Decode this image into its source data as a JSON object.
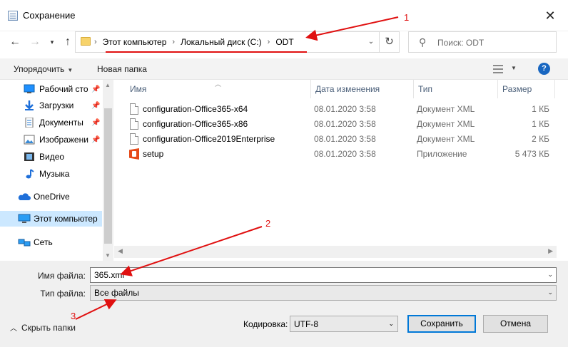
{
  "window": {
    "title": "Сохранение",
    "close_glyph": "✕"
  },
  "address": {
    "crumbs": [
      "Этот компьютер",
      "Локальный диск (C:)",
      "ODT"
    ],
    "separator": "›"
  },
  "search": {
    "placeholder": "Поиск: ODT"
  },
  "toolbar": {
    "organize_label": "Упорядочить",
    "new_folder_label": "Новая папка",
    "help_glyph": "?"
  },
  "sidebar": {
    "items": [
      {
        "label": "Рабочий сто",
        "icon": "desktop-icon",
        "pinned": true
      },
      {
        "label": "Загрузки",
        "icon": "download-icon",
        "pinned": true
      },
      {
        "label": "Документы",
        "icon": "documents-icon",
        "pinned": true
      },
      {
        "label": "Изображени",
        "icon": "pictures-icon",
        "pinned": true
      },
      {
        "label": "Видео",
        "icon": "video-icon",
        "pinned": false
      },
      {
        "label": "Музыка",
        "icon": "music-icon",
        "pinned": false
      },
      {
        "label": "OneDrive",
        "icon": "onedrive-icon",
        "pinned": false
      },
      {
        "label": "Этот компьютер",
        "icon": "computer-icon",
        "pinned": false,
        "selected": true
      },
      {
        "label": "Сеть",
        "icon": "network-icon",
        "pinned": false
      }
    ]
  },
  "columns": {
    "name": "Имя",
    "date": "Дата изменения",
    "type": "Тип",
    "size": "Размер"
  },
  "files": [
    {
      "name": "configuration-Office365-x64",
      "date": "08.01.2020 3:58",
      "type": "Документ XML",
      "size": "1 КБ",
      "icon": "xml-file-icon"
    },
    {
      "name": "configuration-Office365-x86",
      "date": "08.01.2020 3:58",
      "type": "Документ XML",
      "size": "1 КБ",
      "icon": "xml-file-icon"
    },
    {
      "name": "configuration-Office2019Enterprise",
      "date": "08.01.2020 3:58",
      "type": "Документ XML",
      "size": "2 КБ",
      "icon": "xml-file-icon"
    },
    {
      "name": "setup",
      "date": "08.01.2020 3:58",
      "type": "Приложение",
      "size": "5 473 КБ",
      "icon": "office-app-icon"
    }
  ],
  "form": {
    "filename_label": "Имя файла:",
    "filename_value": "365.xml",
    "filetype_label": "Тип файла:",
    "filetype_value": "Все файлы",
    "hide_folders_label": "Скрыть папки",
    "encoding_label": "Кодировка:",
    "encoding_value": "UTF-8",
    "save_label": "Сохранить",
    "cancel_label": "Отмена"
  },
  "annotations": {
    "marker_1": "1",
    "marker_2": "2",
    "marker_3": "3",
    "color": "#e01010"
  }
}
